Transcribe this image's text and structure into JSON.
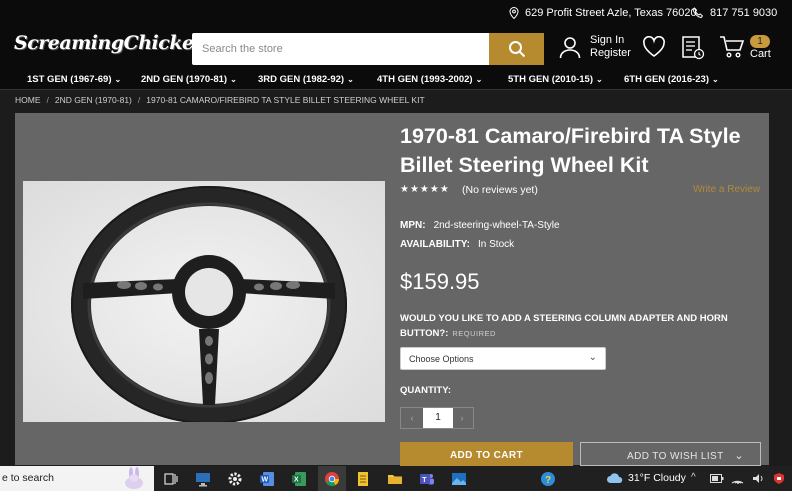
{
  "topbar": {
    "address": "629 Profit Street Azle, Texas 76020",
    "phone": "817 751 9030"
  },
  "header": {
    "logo_text": "ScreamingChicken.com",
    "search_placeholder": "Search the store",
    "sign_in": "Sign In",
    "register": "Register",
    "cart_count": "1",
    "cart_label": "Cart"
  },
  "nav": {
    "items": [
      {
        "label": "1ST GEN (1967-69)"
      },
      {
        "label": "2ND GEN (1970-81)"
      },
      {
        "label": "3RD GEN (1982-92)"
      },
      {
        "label": "4TH GEN (1993-2002)"
      },
      {
        "label": "5TH GEN (2010-15)"
      },
      {
        "label": "6TH GEN (2016-23)"
      }
    ]
  },
  "breadcrumb": {
    "items": [
      "HOME",
      "2ND GEN (1970-81)",
      "1970-81 CAMARO/FIREBIRD TA STYLE BILLET STEERING WHEEL KIT"
    ]
  },
  "product": {
    "title": "1970-81 Camaro/Firebird TA Style Billet Steering Wheel Kit",
    "stars": "★★★★★",
    "reviews": "(No reviews yet)",
    "write_review": "Write a Review",
    "mpn_label": "MPN:",
    "mpn": "2nd-steering-wheel-TA-Style",
    "availability_label": "AVAILABILITY:",
    "availability": "In Stock",
    "price": "$159.95",
    "option_label": "WOULD YOU LIKE TO ADD A STEERING COLUMN ADAPTER AND HORN BUTTON?:",
    "option_required": "REQUIRED",
    "option_selected": "Choose Options",
    "quantity_label": "QUANTITY:",
    "quantity": "1",
    "add_to_cart": "ADD TO CART",
    "add_to_wishlist": "ADD TO WISH LIST"
  },
  "taskbar": {
    "search_text": "e to search",
    "weather": "31°F  Cloudy"
  },
  "colors": {
    "accent": "#b68a2e",
    "header_bg": "#0b0b0b",
    "panel_bg": "#666666"
  }
}
